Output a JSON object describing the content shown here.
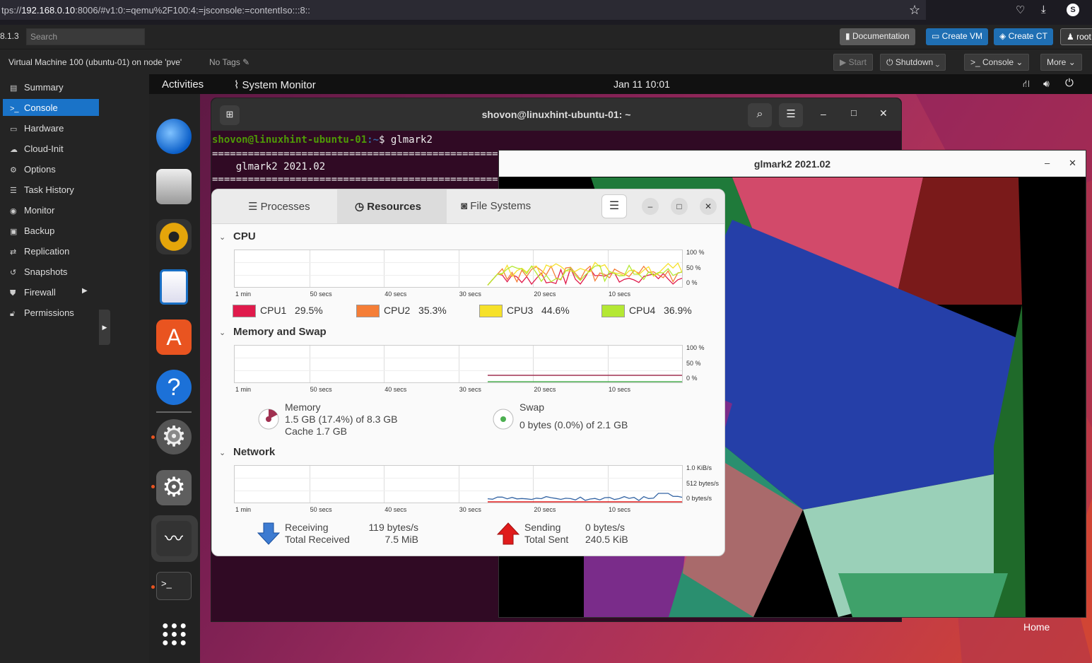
{
  "browser": {
    "url_prefix": "tps://",
    "url_host": "192.168.0.10",
    "url_rest": ":8006/#v1:0:=qemu%2F100:4:=jsconsole:=contentIso:::8::"
  },
  "pve": {
    "version": "8.1.3",
    "search_placeholder": "Search",
    "documentation": "Documentation",
    "create_vm": "Create VM",
    "create_ct": "Create CT",
    "user": "root",
    "vm_title": "Virtual Machine 100 (ubuntu-01) on node 'pve'",
    "no_tags": "No Tags",
    "start": "Start",
    "shutdown": "Shutdown",
    "console": "Console",
    "more": "More",
    "sidebar": [
      "Summary",
      "Console",
      "Hardware",
      "Cloud-Init",
      "Options",
      "Task History",
      "Monitor",
      "Backup",
      "Replication",
      "Snapshots",
      "Firewall",
      "Permissions"
    ]
  },
  "gnome": {
    "activities": "Activities",
    "app": "System Monitor",
    "clock": "Jan 11  10:01",
    "home": "Home"
  },
  "terminal": {
    "title": "shovon@linuxhint-ubuntu-01: ~",
    "prompt_user": "shovon@linuxhint-ubuntu-01",
    "prompt_path": ":~",
    "command": "$ glmark2",
    "rule": "==========================================================================",
    "line2": "    glmark2 2021.02"
  },
  "glmark": {
    "title": "glmark2 2021.02"
  },
  "sysmon": {
    "tabs": [
      "Processes",
      "Resources",
      "File Systems"
    ],
    "cpu_title": "CPU",
    "mem_title": "Memory and Swap",
    "net_title": "Network",
    "cpu_y": [
      "100 %",
      "50 %",
      "0 %"
    ],
    "mem_y": [
      "100 %",
      "50 %",
      "0 %"
    ],
    "net_y": [
      "1.0 KiB/s",
      "512 bytes/s",
      "0 bytes/s"
    ],
    "x_labels": [
      "1 min",
      "50 secs",
      "40 secs",
      "30 secs",
      "20 secs",
      "10 secs"
    ],
    "cpu": [
      {
        "name": "CPU1",
        "value": "29.5%",
        "color": "#e01b4c"
      },
      {
        "name": "CPU2",
        "value": "35.3%",
        "color": "#f57e37"
      },
      {
        "name": "CPU3",
        "value": "44.6%",
        "color": "#f6e12a"
      },
      {
        "name": "CPU4",
        "value": "36.9%",
        "color": "#b4e834"
      }
    ],
    "memory": {
      "label": "Memory",
      "used": "1.5 GB (17.4%) of 8.3 GB",
      "cache": "Cache 1.7 GB",
      "fraction": 0.174
    },
    "swap": {
      "label": "Swap",
      "used": "0 bytes (0.0%) of 2.1 GB",
      "fraction": 0.0
    },
    "network": {
      "receiving_label": "Receiving",
      "receiving": "119 bytes/s",
      "total_received_label": "Total Received",
      "total_received": "7.5 MiB",
      "sending_label": "Sending",
      "sending": "0 bytes/s",
      "total_sent_label": "Total Sent",
      "total_sent": "240.5 KiB"
    },
    "colors": {
      "receive": "#3465a4",
      "send": "#e01b1b",
      "memory": "#a03050",
      "swap": "#4caf50"
    }
  }
}
